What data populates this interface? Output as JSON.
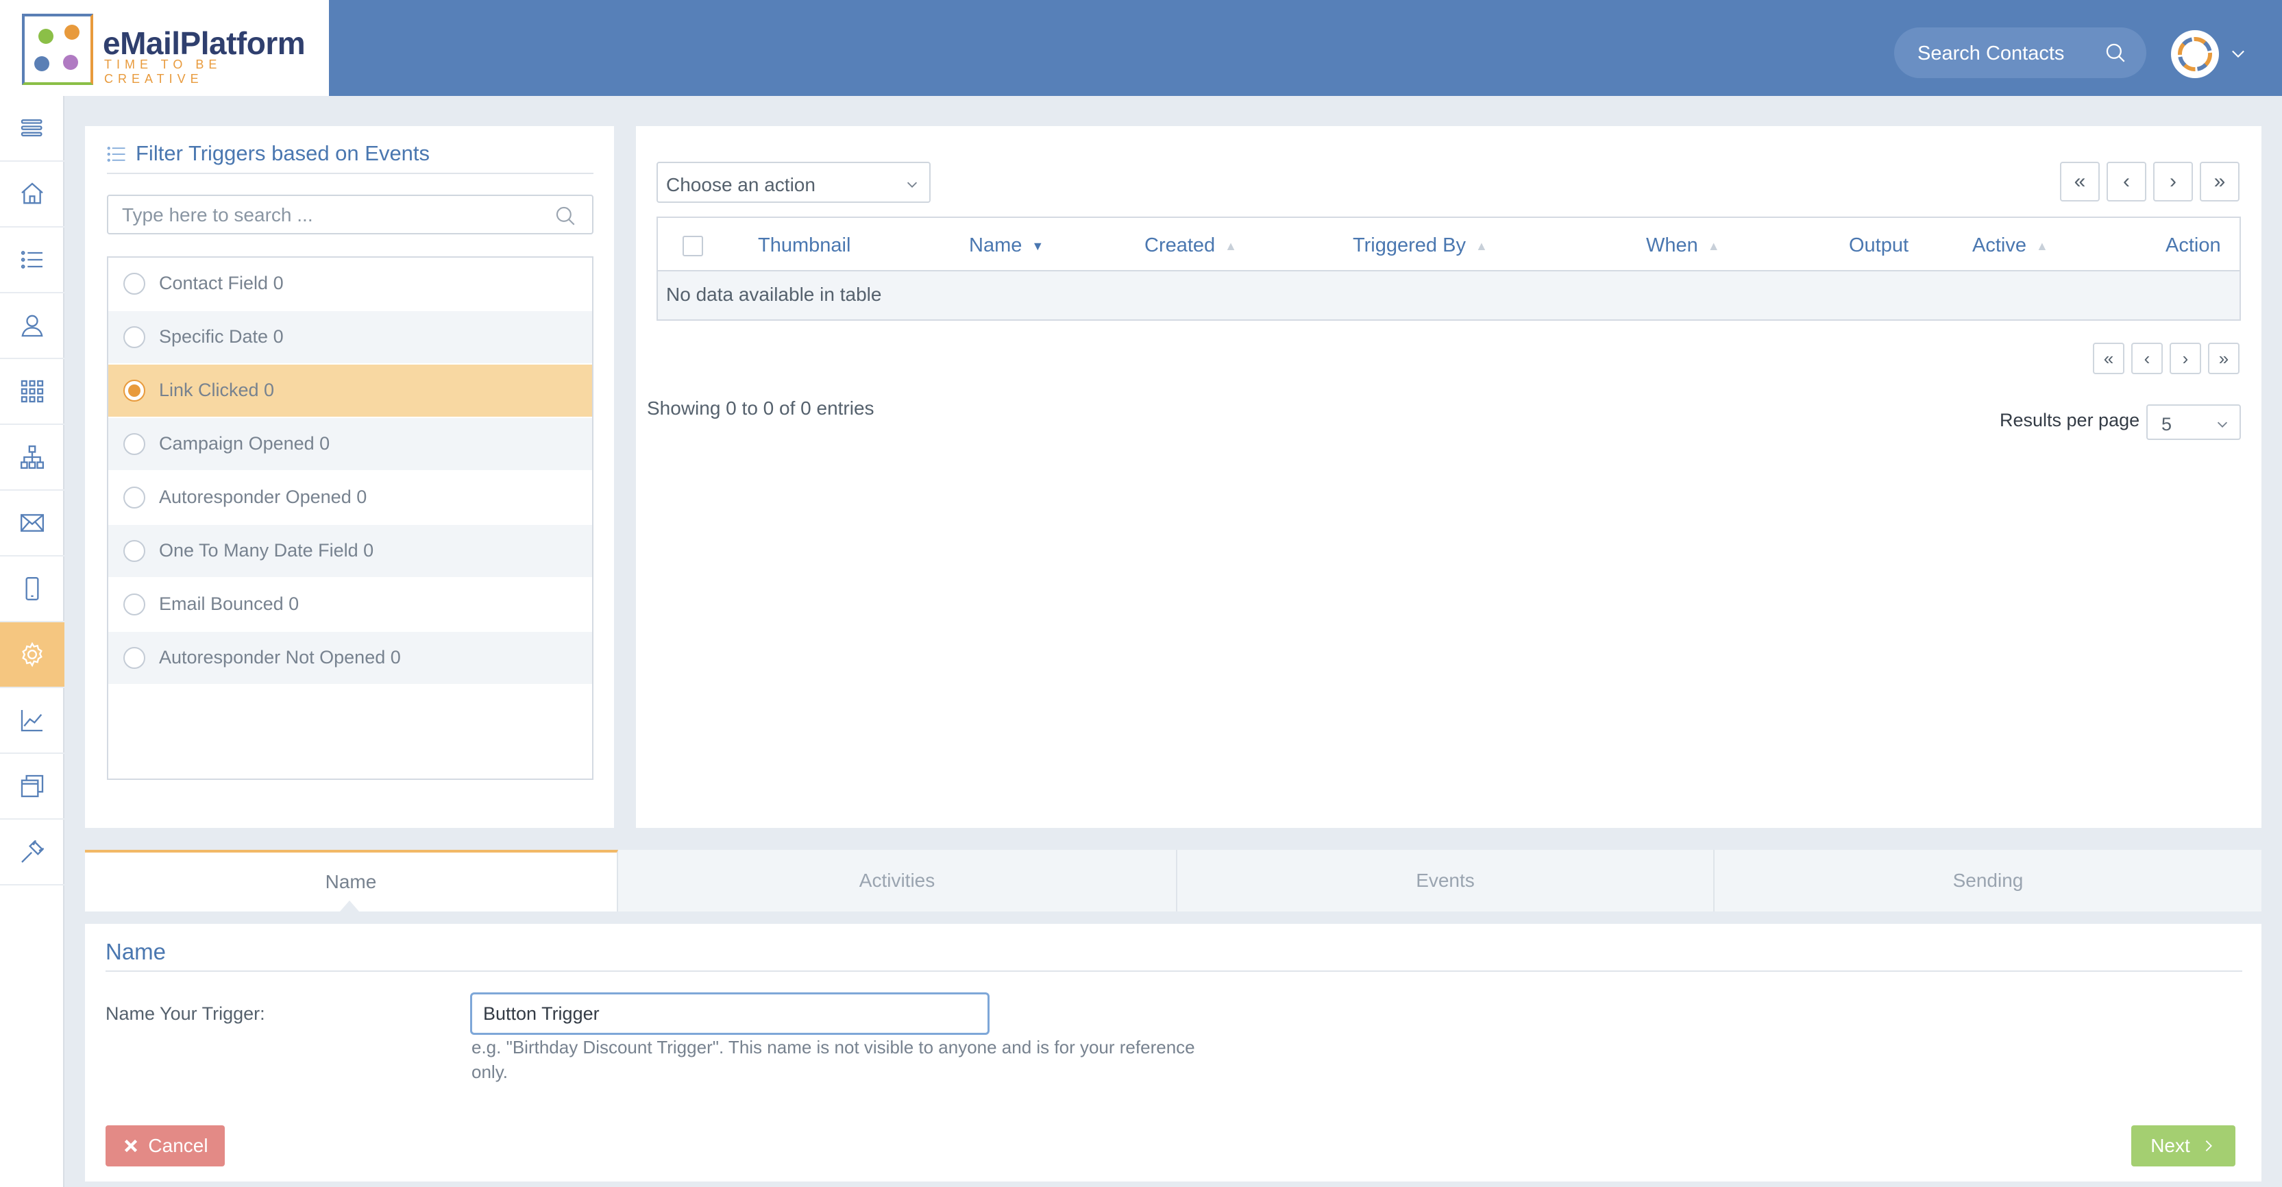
{
  "brand": {
    "name": "eMailPlatform",
    "tagline": "TIME TO BE CREATIVE"
  },
  "header": {
    "search_placeholder": "Search Contacts",
    "search_icon": "search-icon",
    "avatar_icon": "avatar",
    "menu_icon": "chevron-down-icon"
  },
  "sidebar": {
    "items": [
      {
        "icon": "menu-toggle-icon",
        "active": false
      },
      {
        "icon": "home-icon",
        "active": false
      },
      {
        "icon": "list-icon",
        "active": false
      },
      {
        "icon": "contacts-icon",
        "active": false
      },
      {
        "icon": "apps-grid-icon",
        "active": false
      },
      {
        "icon": "sitemap-icon",
        "active": false
      },
      {
        "icon": "mail-icon",
        "active": false
      },
      {
        "icon": "mobile-icon",
        "active": false
      },
      {
        "icon": "gear-icon",
        "active": true
      },
      {
        "icon": "chart-icon",
        "active": false
      },
      {
        "icon": "windows-icon",
        "active": false
      },
      {
        "icon": "plug-icon",
        "active": false
      }
    ],
    "active_color": "#f5c680"
  },
  "filter": {
    "title": "Filter Triggers based on Events",
    "search_placeholder": "Type here to search ...",
    "events": [
      {
        "label": "Contact Field 0",
        "selected": false
      },
      {
        "label": "Specific Date 0",
        "selected": false
      },
      {
        "label": "Link Clicked 0",
        "selected": true
      },
      {
        "label": "Campaign Opened 0",
        "selected": false
      },
      {
        "label": "Autoresponder Opened 0",
        "selected": false
      },
      {
        "label": "One To Many Date Field 0",
        "selected": false
      },
      {
        "label": "Email Bounced 0",
        "selected": false
      },
      {
        "label": "Autoresponder Not Opened 0",
        "selected": false
      }
    ]
  },
  "table": {
    "action_select": "Choose an action",
    "columns": [
      "Thumbnail",
      "Name",
      "Created",
      "Triggered By",
      "When",
      "Output",
      "Active",
      "Action"
    ],
    "empty_text": "No data available in table",
    "pager": {
      "first": "«",
      "prev": "‹",
      "next": "›",
      "last": "»"
    },
    "showing": "Showing 0 to 0 of 0 entries",
    "results_per_page_label": "Results per page",
    "results_per_page_value": "5"
  },
  "tabs": [
    "Name",
    "Activities",
    "Events",
    "Sending"
  ],
  "active_tab": "Name",
  "form": {
    "section_title": "Name",
    "field_label": "Name Your Trigger:",
    "field_value": "Button Trigger",
    "help_text": "e.g. \"Birthday Discount Trigger\". This name is not visible to anyone and is for your reference only.",
    "cancel_label": "Cancel",
    "cancel_icon": "close-icon",
    "next_label": "Next",
    "next_icon": "chevron-right-icon"
  },
  "colors": {
    "header": "#5780b8",
    "accent": "#4a77b0",
    "selected_row": "#f8d8a2",
    "cancel": "#e38a86",
    "next": "#a4cf71"
  }
}
